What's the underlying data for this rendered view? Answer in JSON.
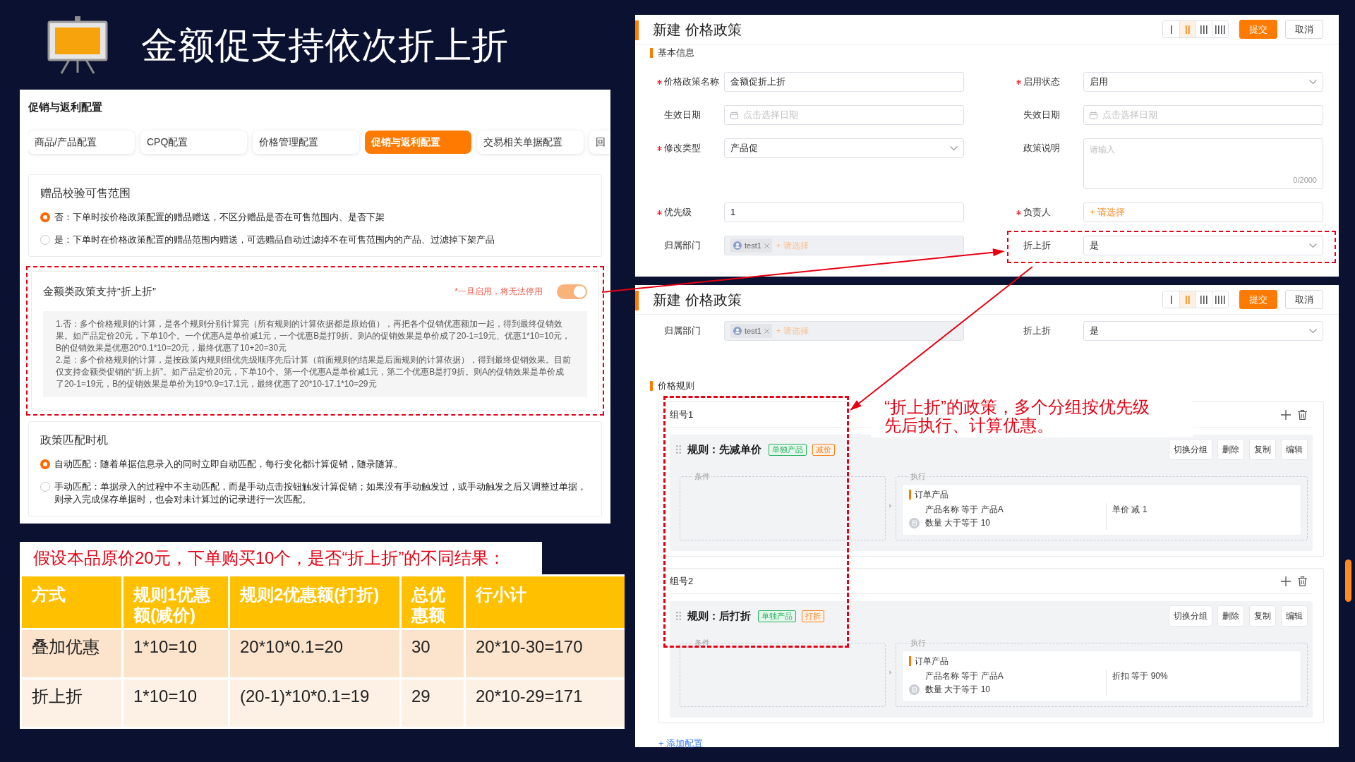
{
  "slide": {
    "title": "金额促支持依次折上折"
  },
  "config_panel": {
    "title": "促销与返利配置",
    "tabs": [
      {
        "label": "商品/产品配置",
        "selected": false
      },
      {
        "label": "CPQ配置",
        "selected": false
      },
      {
        "label": "价格管理配置",
        "selected": false
      },
      {
        "label": "促销与返利配置",
        "selected": true
      },
      {
        "label": "交易相关单据配置",
        "selected": false
      },
      {
        "label": "回",
        "selected": false
      }
    ],
    "sections": [
      {
        "kind": "radio",
        "title": "赠品校验可售范围",
        "highlighted": false,
        "options": [
          {
            "label": "否：下单时按价格政策配置的赠品赠送，不区分赠品是否在可售范围内、是否下架",
            "selected": true
          },
          {
            "label": "是：下单时在价格政策配置的赠品范围内赠送，可选赠品自动过滤掉不在可售范围内的产品、过滤掉下架产品",
            "selected": false
          }
        ]
      },
      {
        "kind": "toggle",
        "title": "金额类政策支持“折上折”",
        "highlighted": true,
        "note": "*一旦启用，将无法停用",
        "on": true,
        "description": [
          "1.否：多个价格规则的计算，是各个规则分别计算完（所有规则的计算依据都是原始值），再把各个促销优惠额加一起，得到最终促销效果。如产品定价20元，下单10个。一个优惠A是单价减1元，一个优惠B是打9折。则A的促销效果是单价成了20-1=19元、优惠1*10=10元，B的促销效果是优惠20*0.1*10=20元，最终优惠了10+20=30元",
          "2.是：多个价格规则的计算，是按政策内规则组优先级顺序先后计算（前面规则的结果是后面规则的计算依据），得到最终促销效果。目前仅支持金额类促销的“折上折”。如产品定价20元，下单10个。第一个优惠A是单价减1元，第二个优惠B是打9折。则A的促销效果是单价成了20-1=19元，B的促销效果是单价为19*0.9=17.1元，最终优惠了20*10-17.1*10=29元"
        ]
      },
      {
        "kind": "radio",
        "title": "政策匹配时机",
        "highlighted": false,
        "options": [
          {
            "label": "自动匹配：随着单据信息录入的同时立即自动匹配，每行变化都计算促销，随录随算。",
            "selected": true
          },
          {
            "label": "手动匹配：单据录入的过程中不主动匹配，而是手动点击按钮触发计算促销；如果没有手动触发过，或手动触发之后又调整过单据，则录入完成保存单据时，也会对未计算过的记录进行一次匹配。",
            "selected": false
          }
        ]
      }
    ]
  },
  "comparison": {
    "caption": "假设本品原价20元，下单购买10个，是否“折上折”的不同结果：",
    "columns": [
      "方式",
      "规则1优惠额(减价)",
      "规则2优惠额(打折)",
      "总优惠额",
      "行小计"
    ],
    "rows": [
      [
        "叠加优惠",
        "1*10=10",
        "20*10*0.1=20",
        "30",
        "20*10-30=170"
      ],
      [
        "折上折",
        "1*10=10",
        "(20-1)*10*0.1=19",
        "29",
        "20*10-29=171"
      ]
    ]
  },
  "policy_forms": [
    {
      "title": "新建 价格政策",
      "layouts": [
        {
          "selected": false
        },
        {
          "selected": true
        },
        {
          "selected": false
        },
        {
          "selected": false
        }
      ],
      "buttons": [
        {
          "label": "提交",
          "kind": "primary"
        },
        {
          "label": "取消",
          "kind": "default"
        }
      ],
      "section": "基本信息",
      "fields": [
        {
          "label": "价格政策名称",
          "required": true,
          "kind": "text",
          "value": "金额促折上折",
          "disabled": false,
          "highlighted": false
        },
        {
          "label": "启用状态",
          "required": true,
          "kind": "select",
          "value": "启用",
          "disabled": false,
          "highlighted": false
        },
        {
          "label": "生效日期",
          "required": false,
          "kind": "date",
          "placeholder": "点击选择日期",
          "disabled": false,
          "highlighted": false
        },
        {
          "label": "失效日期",
          "required": false,
          "kind": "date",
          "placeholder": "点击选择日期",
          "disabled": false,
          "highlighted": false
        },
        {
          "label": "修改类型",
          "required": true,
          "kind": "select",
          "value": "产品促",
          "disabled": false,
          "highlighted": false
        },
        {
          "label": "政策说明",
          "required": false,
          "kind": "textarea",
          "placeholder": "请输入",
          "counter": "0/2000",
          "disabled": false,
          "highlighted": false
        },
        {
          "label": "优先级",
          "required": true,
          "kind": "text",
          "value": "1",
          "disabled": false,
          "highlighted": false
        },
        {
          "label": "负责人",
          "required": true,
          "kind": "picker",
          "placeholder": "+ 请选择",
          "disabled": false,
          "highlighted": false
        },
        {
          "label": "归属部门",
          "required": false,
          "kind": "tags",
          "tags": [
            "test1"
          ],
          "placeholder": "+ 请选择",
          "disabled": true,
          "highlighted": false
        },
        {
          "label": "折上折",
          "required": false,
          "kind": "select",
          "value": "是",
          "disabled": false,
          "highlighted": true
        }
      ]
    },
    {
      "title": "新建 价格政策",
      "layouts": [
        {
          "selected": false
        },
        {
          "selected": true
        },
        {
          "selected": false
        },
        {
          "selected": false
        }
      ],
      "buttons": [
        {
          "label": "提交",
          "kind": "primary"
        },
        {
          "label": "取消",
          "kind": "default"
        }
      ],
      "fields": [
        {
          "label": "归属部门",
          "required": false,
          "kind": "tags",
          "tags": [
            "test1"
          ],
          "placeholder": "+ 请选择",
          "disabled": true,
          "highlighted": false
        },
        {
          "label": "折上折",
          "required": false,
          "kind": "select",
          "value": "是",
          "disabled": false,
          "highlighted": false
        }
      ],
      "rules": {
        "title": "价格规则",
        "groups": [
          {
            "title": "组号1",
            "rule": {
              "title": "规则：先减单价",
              "tags": [
                {
                  "label": "单独产品",
                  "color": "#27b25f"
                },
                {
                  "label": "减价",
                  "color": "#f5821f"
                }
              ],
              "actions": [
                "切换分组",
                "删除",
                "复制",
                "编辑"
              ],
              "condition_label": "条件",
              "execution_label": "执行",
              "target": "订单产品",
              "conditions": [
                "产品名称 等于 产品A",
                "数量 大于等于 10"
              ],
              "result": "单价 减 1"
            }
          },
          {
            "title": "组号2",
            "rule": {
              "title": "规则：后打折",
              "tags": [
                {
                  "label": "单独产品",
                  "color": "#27b25f"
                },
                {
                  "label": "打折",
                  "color": "#f5821f"
                }
              ],
              "actions": [
                "切换分组",
                "删除",
                "复制",
                "编辑"
              ],
              "condition_label": "条件",
              "execution_label": "执行",
              "target": "订单产品",
              "conditions": [
                "产品名称 等于 产品A",
                "数量 大于等于 10"
              ],
              "result": "折扣 等于 90%"
            }
          }
        ],
        "add_link": "+ 添加配置"
      }
    }
  ],
  "annotation": {
    "lines": [
      "“折上折”的政策，多个分组按优先级",
      "先后执行、计算优惠。"
    ]
  }
}
